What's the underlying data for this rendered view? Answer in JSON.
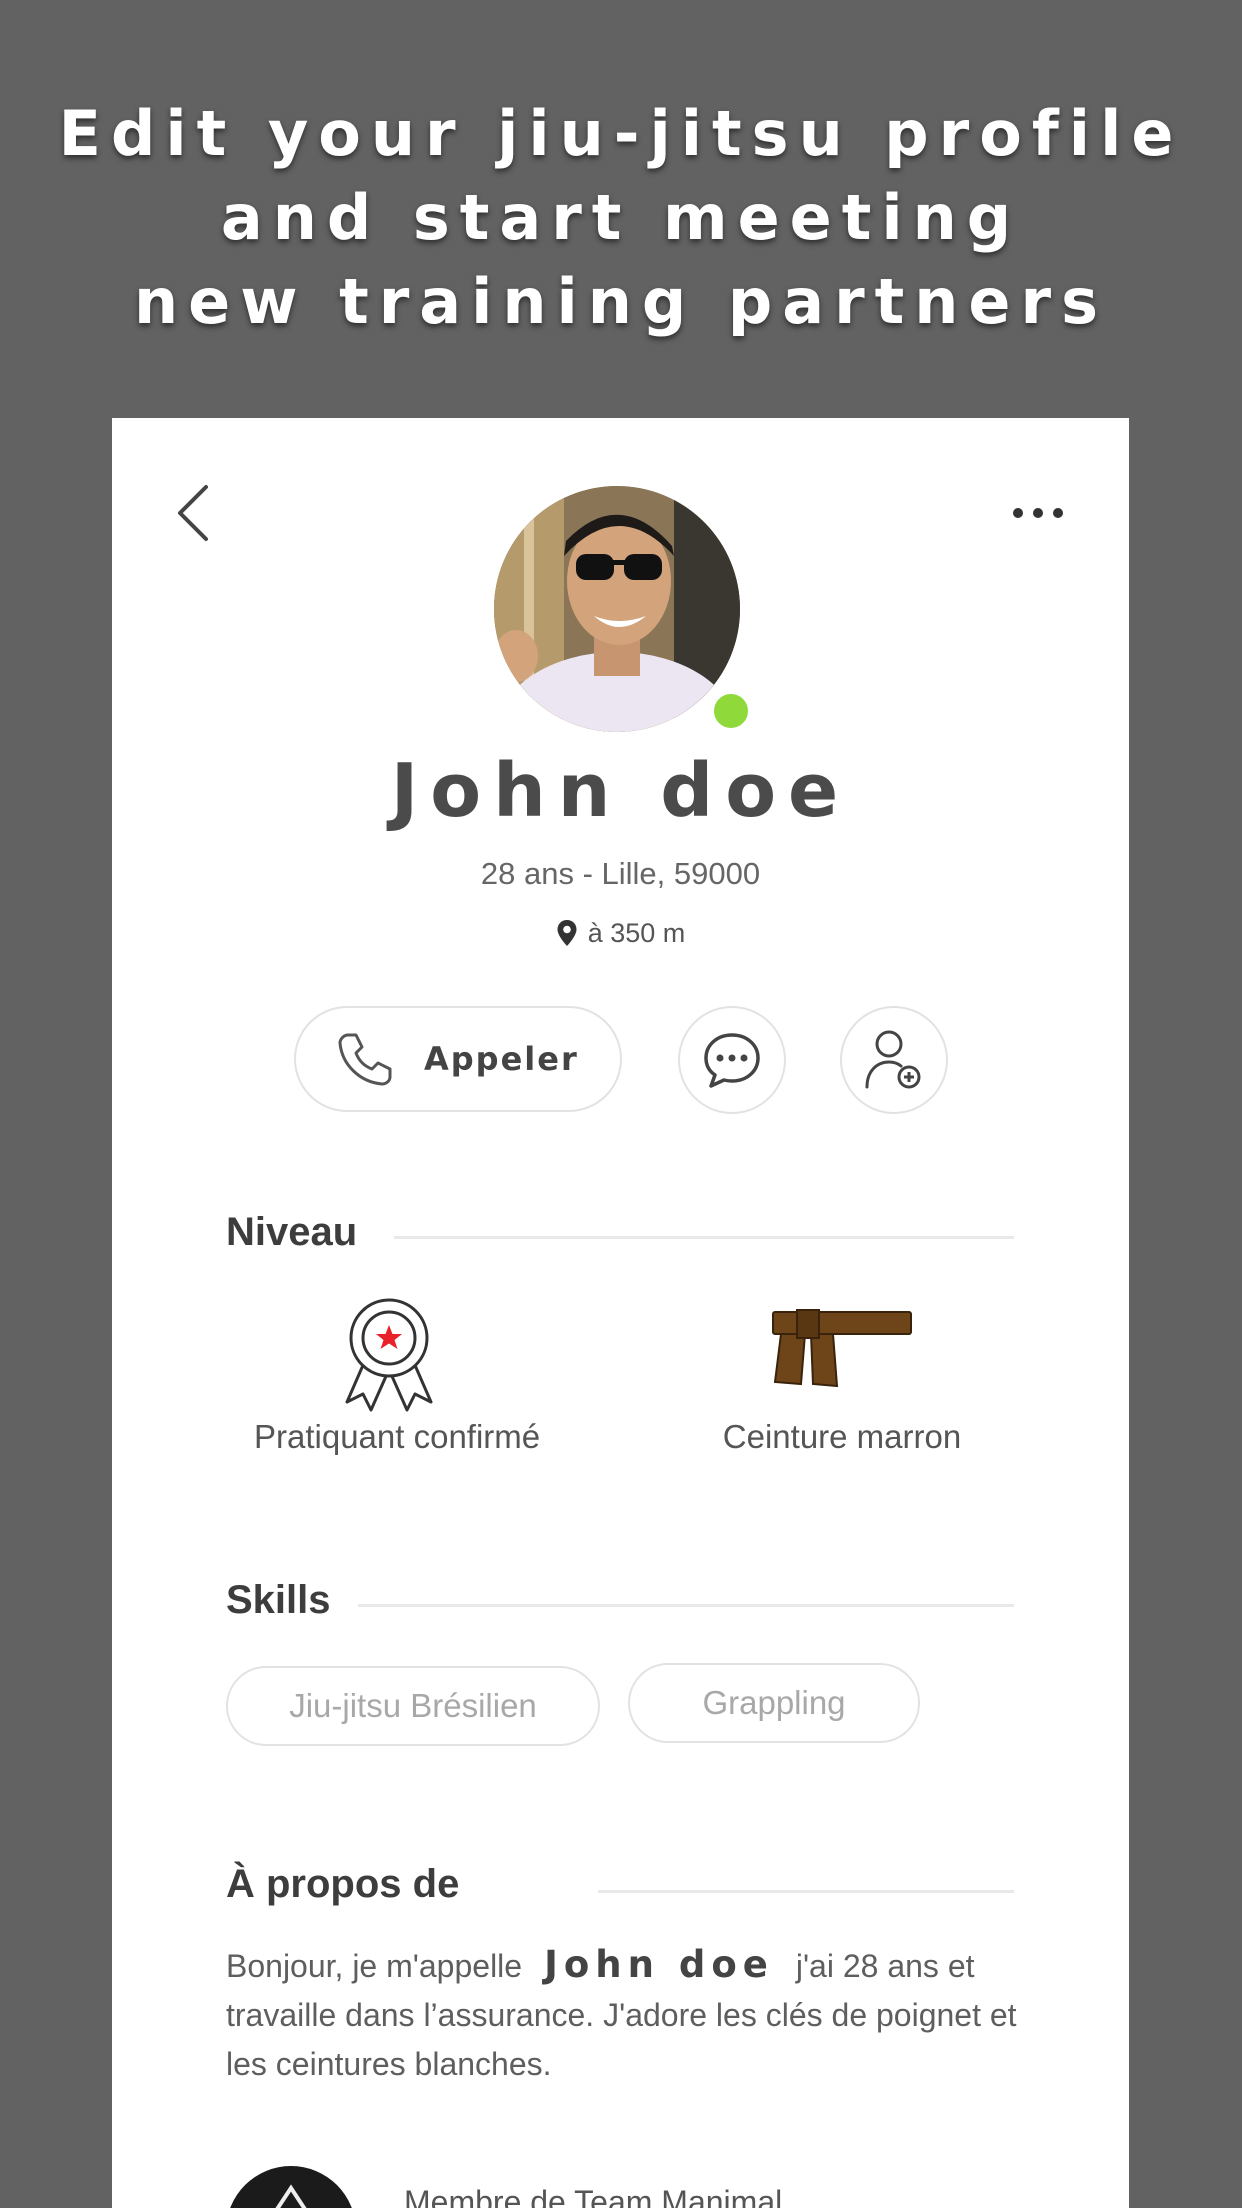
{
  "headline": {
    "line1": "Edit your jiu-jitsu profile",
    "line2": "and start meeting",
    "line3": "new training partners"
  },
  "profile": {
    "name": "John doe",
    "subinfo": "28 ans - Lille, 59000",
    "distance": "à 350 m",
    "online": true
  },
  "actions": {
    "call_label": "Appeler"
  },
  "niveau": {
    "title": "Niveau",
    "experience": "Pratiquant confirmé",
    "belt": "Ceinture marron",
    "belt_color": "#6e4419"
  },
  "skills": {
    "title": "Skills",
    "items": [
      "Jiu-jitsu Brésilien",
      "Grappling"
    ]
  },
  "about": {
    "title": "À propos de",
    "intro": "Bonjour, je m'appelle",
    "name": "John doe",
    "rest_line1": "j'ai 28 ans",
    "rest": "et travaille dans l’assurance. J'adore les clés de poignet et les ceintures blanches."
  },
  "team": {
    "text": "Membre de Team Manimal"
  },
  "colors": {
    "background": "#626262",
    "online": "#8fd93b",
    "badge_star": "#e8212a"
  }
}
